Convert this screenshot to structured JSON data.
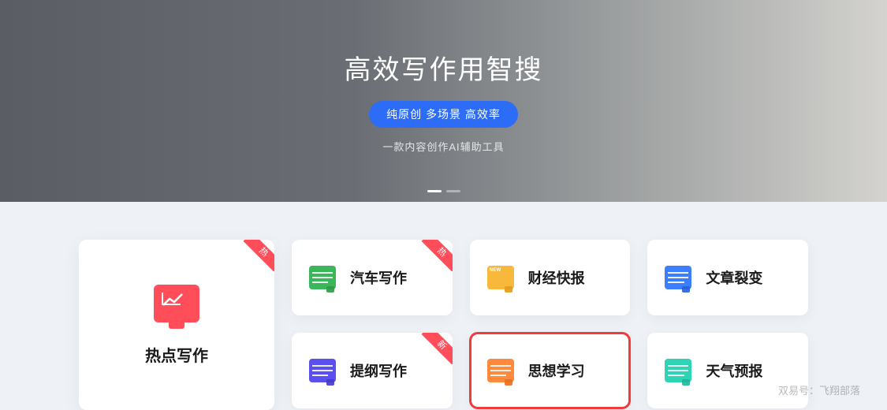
{
  "hero": {
    "title": "高效写作用智搜",
    "badge": "纯原创 多场景 高效率",
    "subtitle": "一款内容创作AI辅助工具"
  },
  "ribbons": {
    "hot": "热",
    "new": "新"
  },
  "big": {
    "label": "热点写作",
    "ribbon": "hot"
  },
  "cards": [
    [
      {
        "label": "汽车写作",
        "icon": "green",
        "ribbon": "hot",
        "name": "card-car-writing"
      },
      {
        "label": "财经快报",
        "icon": "yellow",
        "name": "card-finance-news"
      },
      {
        "label": "文章裂变",
        "icon": "blue",
        "name": "card-article-split"
      }
    ],
    [
      {
        "label": "提纲写作",
        "icon": "purple",
        "ribbon": "new",
        "name": "card-outline-writing"
      },
      {
        "label": "思想学习",
        "icon": "orange",
        "highlight": true,
        "name": "card-thought-study"
      },
      {
        "label": "天气预报",
        "icon": "teal",
        "name": "card-weather-forecast"
      }
    ]
  ],
  "watermark": "双易号：飞翔部落"
}
